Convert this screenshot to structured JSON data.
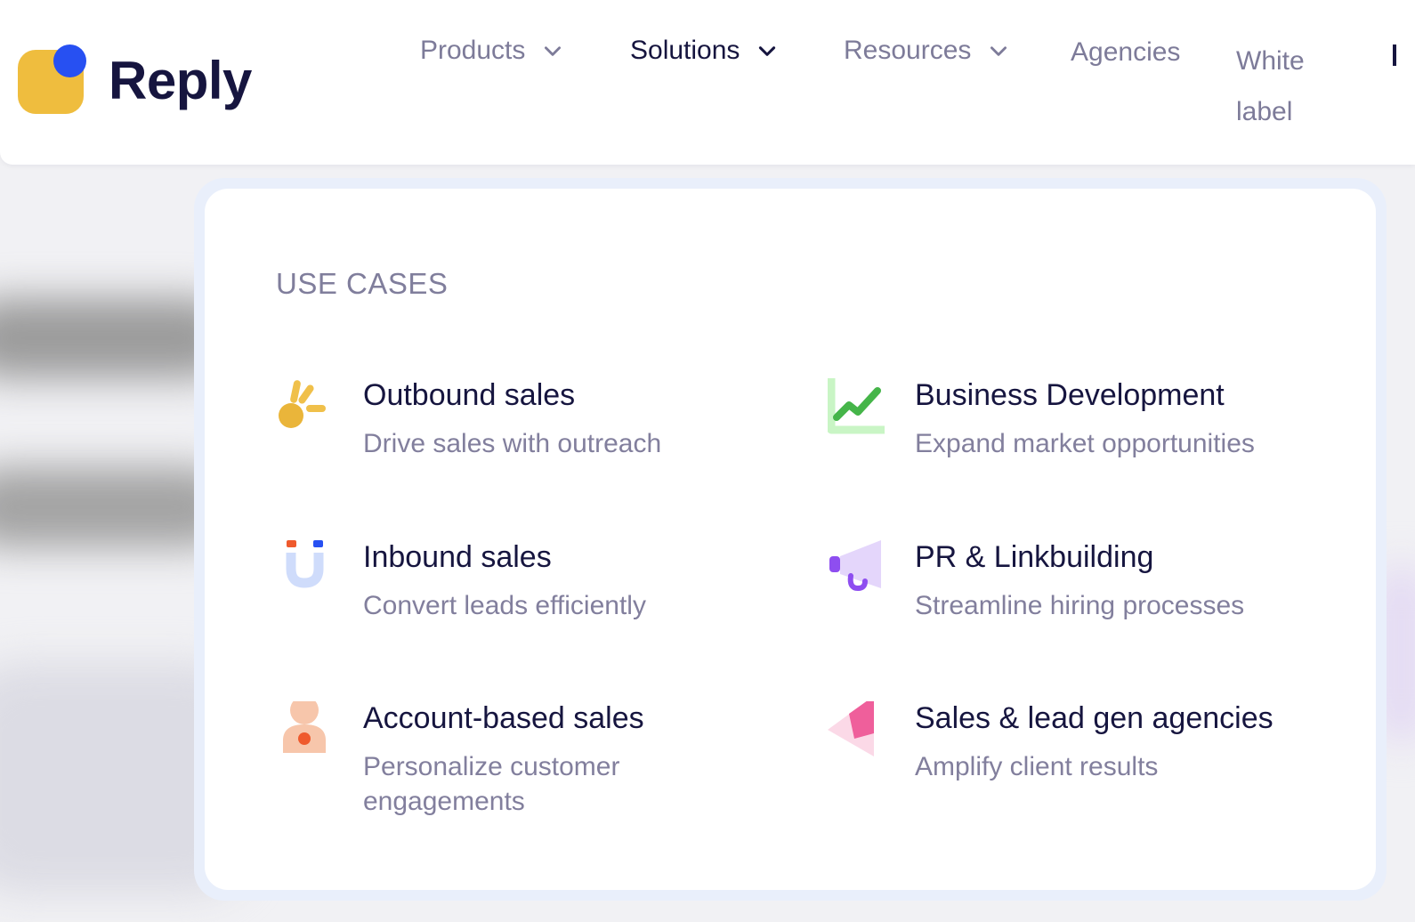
{
  "brand": {
    "name": "Reply",
    "colors": {
      "logo_square": "#efbd3e",
      "logo_dot": "#2750f2"
    }
  },
  "nav": {
    "products": "Products",
    "solutions": "Solutions",
    "resources": "Resources",
    "agencies": "Agencies",
    "white_label_line1": "White",
    "white_label_line2": "label",
    "active_item": "Solutions"
  },
  "dropdown": {
    "heading": "USE CASES",
    "items": [
      {
        "title": "Outbound sales",
        "description": "Drive sales with outreach",
        "icon": "waving-hand-icon"
      },
      {
        "title": "Business Development",
        "description": "Expand market opportunities",
        "icon": "growth-chart-icon"
      },
      {
        "title": "Inbound sales",
        "description": "Convert leads efficiently",
        "icon": "magnet-icon"
      },
      {
        "title": "PR & Linkbuilding",
        "description": "Streamline hiring processes",
        "icon": "megaphone-icon"
      },
      {
        "title": "Account-based sales",
        "description": "Personalize customer engagements",
        "icon": "person-target-icon"
      },
      {
        "title": "Sales & lead gen agencies",
        "description": "Amplify client results",
        "icon": "paper-plane-icon"
      }
    ]
  }
}
